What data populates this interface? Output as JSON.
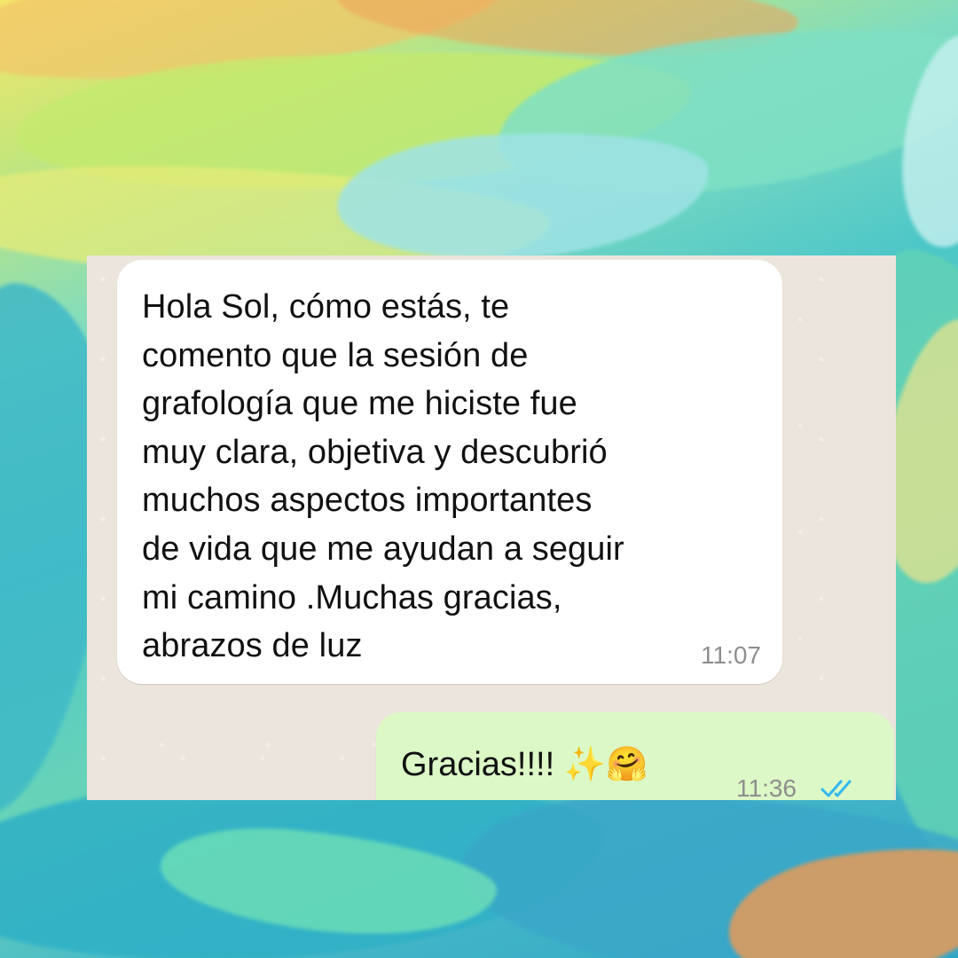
{
  "chat": {
    "incoming": {
      "text": "Hola Sol, cómo estás, te\ncomento que la sesión de\ngrafología que me hiciste fue\nmuy clara, objetiva y descubrió\nmuchos aspectos importantes\nde vida que me ayudan a seguir\nmi camino .Muchas gracias,\nabrazos de luz",
      "time": "11:07"
    },
    "outgoing": {
      "text": "Gracias!!!! ✨🤗",
      "time": "11:36",
      "status_icon": "double-check-read-icon"
    }
  },
  "colors": {
    "chat_background": "#ece5dd",
    "incoming_bubble": "#ffffff",
    "outgoing_bubble": "#dcf8c6",
    "read_ticks": "#34b7f1",
    "time_text": "#8e8e8e"
  }
}
